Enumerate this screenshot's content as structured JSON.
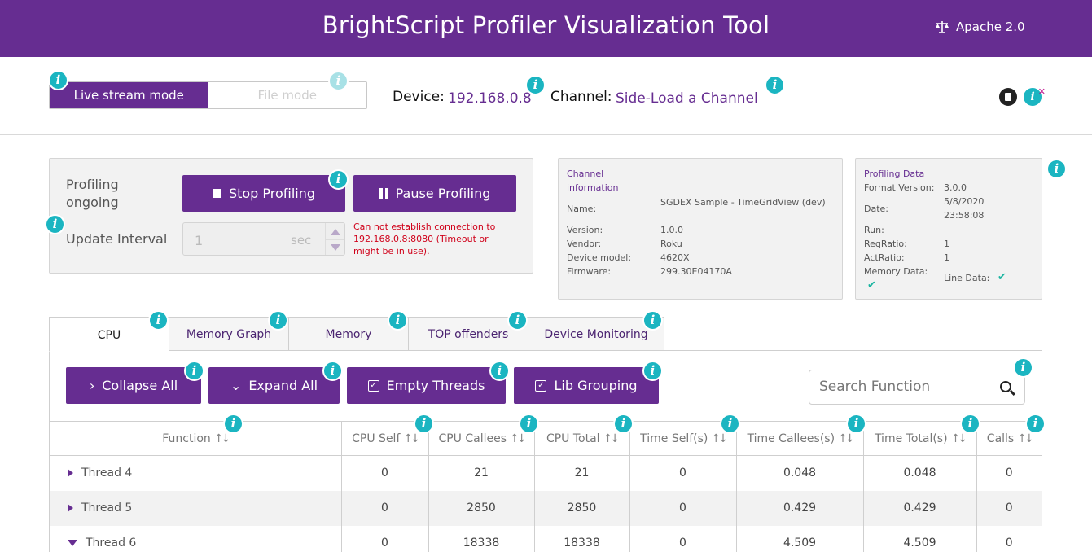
{
  "header": {
    "title": "BrightScript Profiler Visualization Tool",
    "license": "Apache 2.0"
  },
  "info_glyph": "i",
  "mode": {
    "live_label": "Live stream mode",
    "file_label": "File mode"
  },
  "device": {
    "label": "Device:",
    "value": "192.168.0.8"
  },
  "channel": {
    "label": "Channel:",
    "value": "Side-Load a Channel"
  },
  "profiling": {
    "status": "Profiling ongoing",
    "stop_label": "Stop Profiling",
    "pause_label": "Pause Profiling",
    "update_label": "Update Interval",
    "interval_value": "1",
    "interval_unit": "sec",
    "error": "Can not establish connection to 192.168.0.8:8080 (Timeout or might be in use)."
  },
  "channel_info": {
    "heading": "Channel information",
    "name_label": "Name:",
    "name": "SGDEX Sample - TimeGridView (dev)",
    "version_label": "Version:",
    "version": "1.0.0",
    "vendor_label": "Vendor:",
    "vendor": "Roku",
    "model_label": "Device model:",
    "model": "4620X",
    "firmware_label": "Firmware:",
    "firmware": "299.30E04170A"
  },
  "profiling_data": {
    "heading": "Profiling Data",
    "format_label": "Format Version:",
    "format": "3.0.0",
    "date_label": "Date:",
    "date": "5/8/2020 23:58:08",
    "run_label": "Run:",
    "req_label": "ReqRatio:",
    "req": "1",
    "act_label": "ActRatio:",
    "act": "1",
    "memory_label": "Memory Data:",
    "line_label": "Line Data:",
    "check": "✔"
  },
  "tabs": [
    "CPU",
    "Memory Graph",
    "Memory",
    "TOP offenders",
    "Device Monitoring"
  ],
  "toolbar": {
    "collapse": "Collapse All",
    "expand": "Expand All",
    "empty_threads": "Empty Threads",
    "lib_grouping": "Lib Grouping",
    "search_placeholder": "Search Function"
  },
  "table": {
    "sort_glyph": "↑↓",
    "columns": [
      "Function",
      "CPU Self",
      "CPU Callees",
      "CPU Total",
      "Time Self(s)",
      "Time Callees(s)",
      "Time Total(s)",
      "Calls"
    ],
    "rows": [
      {
        "name": "Thread 4",
        "expanded": false,
        "cells": [
          "0",
          "21",
          "21",
          "0",
          "0.048",
          "0.048",
          "0"
        ]
      },
      {
        "name": "Thread 5",
        "expanded": false,
        "cells": [
          "0",
          "2850",
          "2850",
          "0",
          "0.429",
          "0.429",
          "0"
        ]
      },
      {
        "name": "Thread 6",
        "expanded": true,
        "cells": [
          "0",
          "18338",
          "18338",
          "0",
          "4.509",
          "4.509",
          "0"
        ]
      }
    ]
  }
}
